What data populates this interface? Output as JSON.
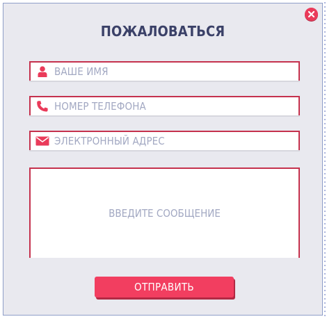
{
  "dialog": {
    "title": "ПОЖАЛОВАТЬСЯ",
    "close_icon": "close-icon"
  },
  "fields": {
    "name": {
      "placeholder": "ВАШЕ ИМЯ",
      "icon": "user-icon"
    },
    "phone": {
      "placeholder": "НОМЕР ТЕЛЕФОНА",
      "icon": "phone-icon"
    },
    "email": {
      "placeholder": "ЭЛЕКТРОННЫЙ АДРЕС",
      "icon": "envelope-icon"
    },
    "message": {
      "placeholder": "ВВЕДИТЕ СООБЩЕНИЕ"
    }
  },
  "submit": {
    "label": "ОТПРАВИТЬ"
  },
  "colors": {
    "accent": "#f23e60",
    "field_border": "#c5314d",
    "title": "#3b4168",
    "placeholder": "#a2a8c2",
    "panel_background": "#e9e9ef"
  }
}
